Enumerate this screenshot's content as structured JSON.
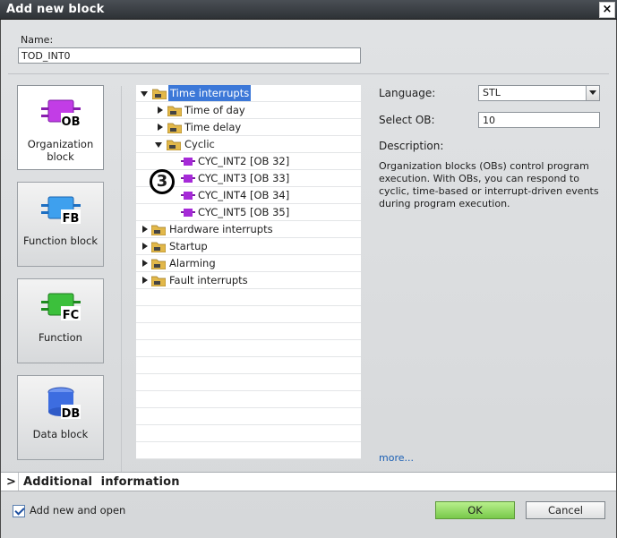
{
  "window": {
    "title": "Add new block",
    "close_glyph": "×"
  },
  "name": {
    "label": "Name:",
    "value": "TOD_INT0"
  },
  "block_types": [
    {
      "label": "Organization\nblock",
      "code": "OB",
      "color": "#b42ad8",
      "selected": true
    },
    {
      "label": "Function block",
      "code": "FB",
      "color": "#2f8fe0",
      "selected": false
    },
    {
      "label": "Function",
      "code": "FC",
      "color": "#2eb32e",
      "selected": false
    },
    {
      "label": "Data block",
      "code": "DB",
      "color": "#3d6de0",
      "selected": false
    }
  ],
  "tree": {
    "nodes": [
      {
        "label": "Time interrupts",
        "level": 0,
        "expand": "open",
        "icon": "folder",
        "selected": true
      },
      {
        "label": "Time of day",
        "level": 1,
        "expand": "closed",
        "icon": "folder"
      },
      {
        "label": "Time delay",
        "level": 1,
        "expand": "closed",
        "icon": "folder"
      },
      {
        "label": "Cyclic",
        "level": 1,
        "expand": "open",
        "icon": "folder"
      },
      {
        "label": "CYC_INT2 [OB 32]",
        "level": 2,
        "expand": "none",
        "icon": "ob"
      },
      {
        "label": "CYC_INT3 [OB 33]",
        "level": 2,
        "expand": "none",
        "icon": "ob"
      },
      {
        "label": "CYC_INT4 [OB 34]",
        "level": 2,
        "expand": "none",
        "icon": "ob"
      },
      {
        "label": "CYC_INT5 [OB 35]",
        "level": 2,
        "expand": "none",
        "icon": "ob"
      },
      {
        "label": "Hardware interrupts",
        "level": 0,
        "expand": "closed",
        "icon": "folder"
      },
      {
        "label": "Startup",
        "level": 0,
        "expand": "closed",
        "icon": "folder"
      },
      {
        "label": "Alarming",
        "level": 0,
        "expand": "closed",
        "icon": "folder"
      },
      {
        "label": "Fault interrupts",
        "level": 0,
        "expand": "closed",
        "icon": "folder"
      }
    ]
  },
  "annotation": {
    "number": "3"
  },
  "properties": {
    "language_label": "Language:",
    "language_value": "STL",
    "select_ob_label": "Select OB:",
    "select_ob_value": "10",
    "description_label": "Description:",
    "description_text": "Organization blocks (OBs) control program execution. With OBs, you can respond to cyclic, time-based or interrupt-driven events during program execution.",
    "more_link": "more..."
  },
  "additional_info": {
    "label": "Additional  information"
  },
  "footer": {
    "add_new_and_open_label": "Add new and open",
    "add_new_and_open_checked": true,
    "ok_label": "OK",
    "cancel_label": "Cancel"
  },
  "colors": {
    "selection": "#3c78d8",
    "ok_button": "#8fd862",
    "ob_icon": "#9b2bd0"
  }
}
